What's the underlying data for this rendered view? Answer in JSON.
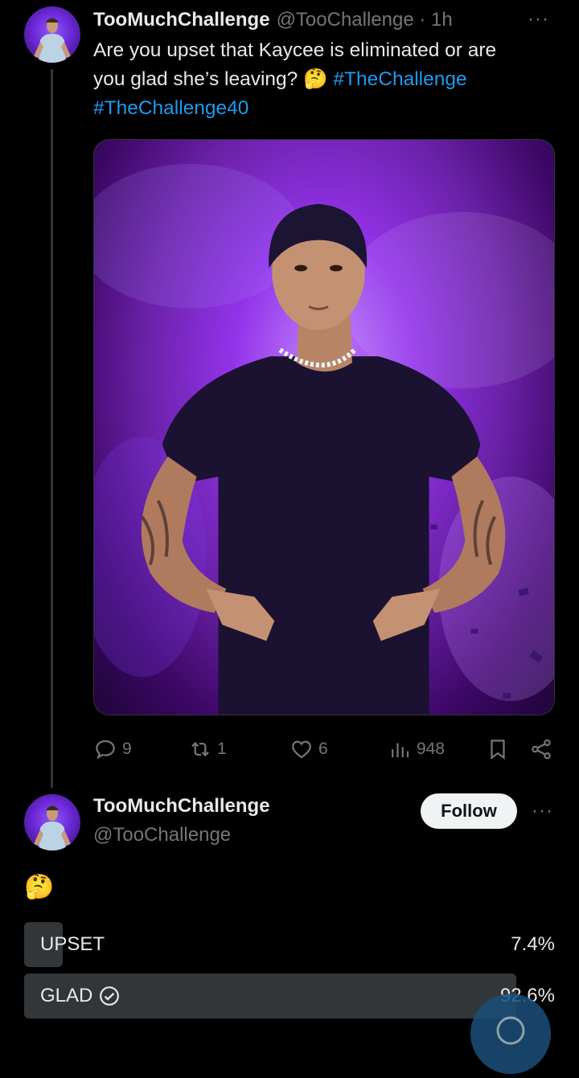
{
  "tweet": {
    "name": "TooMuchChallenge",
    "handle_time": "@TooChallenge · 1h",
    "text_lines": [
      "Are you upset that Kaycee is eliminated or are",
      "you glad she’s leaving?"
    ],
    "emoji": "🤔",
    "hashtag1": "#TheChallenge",
    "hashtag2": "#TheChallenge40",
    "more": "···",
    "stats": {
      "replies": "9",
      "reposts": "1",
      "likes": "6",
      "views": "948"
    }
  },
  "profile": {
    "name": "TooMuchChallenge",
    "handle": "@TooChallenge",
    "follow_label": "Follow",
    "more": "···"
  },
  "reply": {
    "emoji": "🤔"
  },
  "poll": {
    "options": [
      {
        "label": "UPSET",
        "percent": "7.4%",
        "fraction": 0.074,
        "selected": false
      },
      {
        "label": "GLAD",
        "percent": "92.6%",
        "fraction": 0.926,
        "selected": true
      }
    ]
  },
  "colors": {
    "accent": "#1d9bf0",
    "muted": "#71767b",
    "bar": "#333639"
  }
}
